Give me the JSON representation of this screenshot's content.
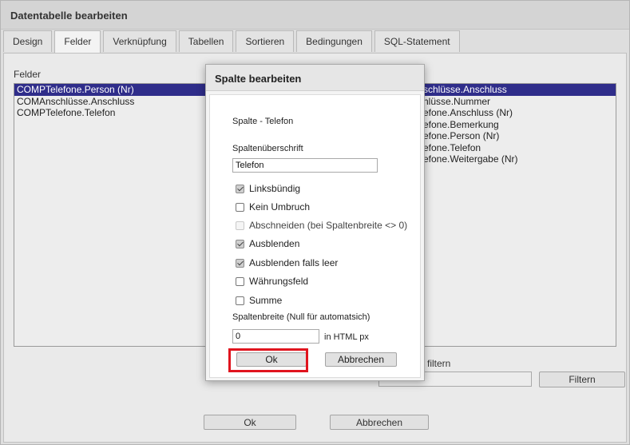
{
  "window": {
    "title": "Datentabelle bearbeiten"
  },
  "tabs": [
    {
      "label": "Design",
      "active": false
    },
    {
      "label": "Felder",
      "active": true
    },
    {
      "label": "Verknüpfung",
      "active": false
    },
    {
      "label": "Tabellen",
      "active": false
    },
    {
      "label": "Sortieren",
      "active": false
    },
    {
      "label": "Bedingungen",
      "active": false
    },
    {
      "label": "SQL-Statement",
      "active": false
    }
  ],
  "felder": {
    "label": "Felder",
    "selected_fields": [
      "COMPTelefone.Person (Nr)",
      "COMAnschlüsse.Anschluss",
      "COMPTelefone.Telefon"
    ],
    "available_fields": [
      "schlüsse.Anschluss",
      "hlüsse.Nummer",
      "efone.Anschluss (Nr)",
      "efone.Bemerkung",
      "efone.Person (Nr)",
      "efone.Telefon",
      "efone.Weitergabe (Nr)"
    ],
    "filter_label": "filtern",
    "filter_value": "",
    "filter_button": "Filtern"
  },
  "footer": {
    "ok_label": "Ok",
    "cancel_label": "Abbrechen"
  },
  "dialog": {
    "title": "Spalte bearbeiten",
    "column_name": "Spalte - Telefon",
    "header_label": "Spaltenüberschrift",
    "header_value": "Telefon",
    "options": [
      {
        "label": "Linksbündig",
        "checked": true,
        "disabled": false
      },
      {
        "label": "Kein Umbruch",
        "checked": false,
        "disabled": false
      },
      {
        "label": "Abschneiden (bei Spaltenbreite <> 0)",
        "checked": false,
        "disabled": true
      },
      {
        "label": "Ausblenden",
        "checked": true,
        "disabled": false
      },
      {
        "label": "Ausblenden falls leer",
        "checked": true,
        "disabled": false
      },
      {
        "label": "Währungsfeld",
        "checked": false,
        "disabled": false
      },
      {
        "label": "Summe",
        "checked": false,
        "disabled": false
      }
    ],
    "width_label": "Spaltenbreite (Null für automatsich)",
    "width_value": "0",
    "width_unit": "in HTML px",
    "ok_label": "Ok",
    "cancel_label": "Abbrechen"
  },
  "colors": {
    "selection": "#2f2d8a",
    "highlight": "#e0141e"
  }
}
